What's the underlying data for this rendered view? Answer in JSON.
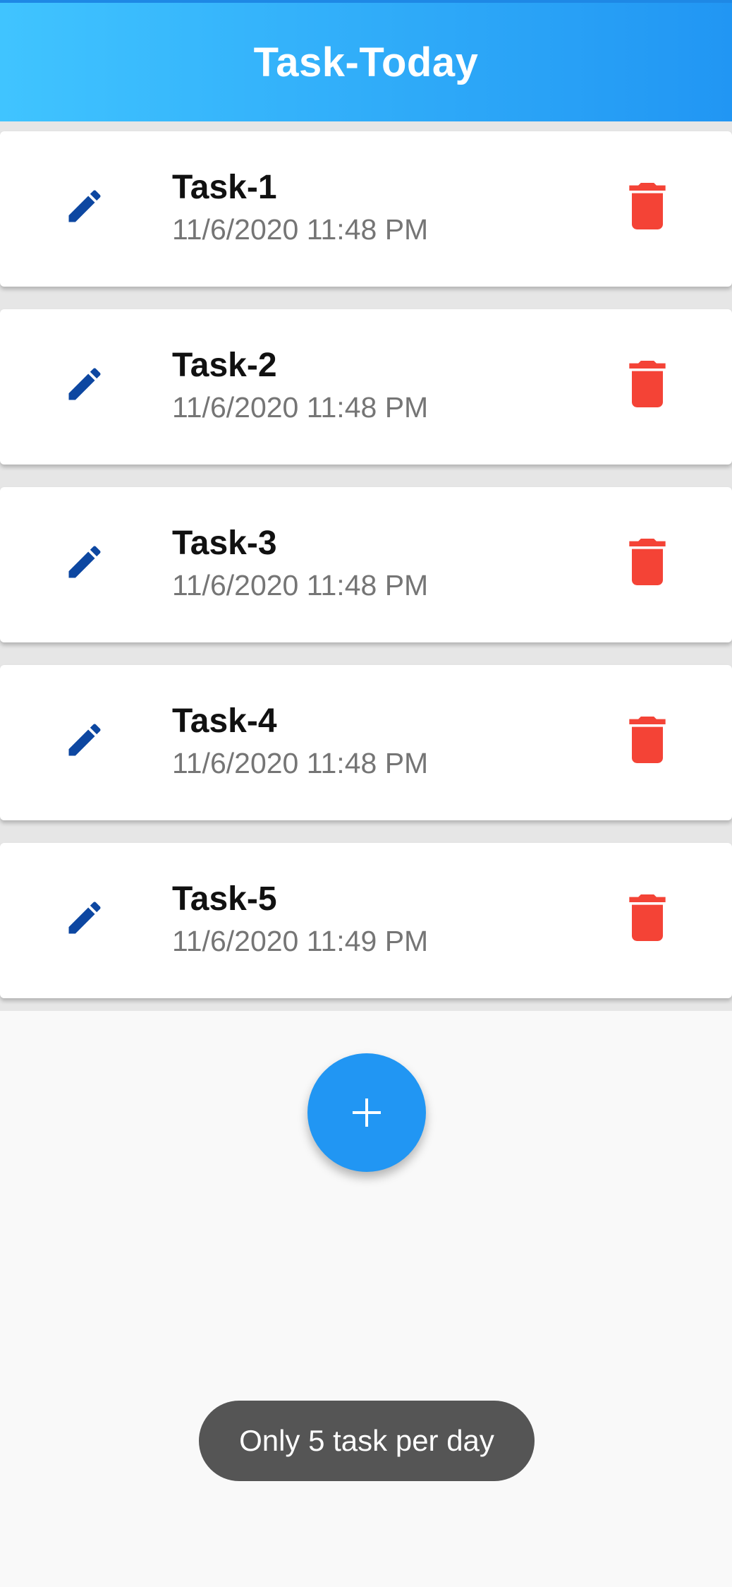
{
  "app_bar": {
    "title": "Task-Today"
  },
  "colors": {
    "app_bar_gradient_start": "#40c4ff",
    "app_bar_gradient_end": "#2196f3",
    "edit_icon": "#0d47a1",
    "delete_icon": "#f44336",
    "fab": "#2196f3",
    "toast_background": "#555555"
  },
  "tasks": [
    {
      "title": "Task-1",
      "time": "11/6/2020 11:48 PM",
      "edit_icon": "pencil-icon",
      "delete_icon": "trash-icon"
    },
    {
      "title": "Task-2",
      "time": "11/6/2020 11:48 PM",
      "edit_icon": "pencil-icon",
      "delete_icon": "trash-icon"
    },
    {
      "title": "Task-3",
      "time": "11/6/2020 11:48 PM",
      "edit_icon": "pencil-icon",
      "delete_icon": "trash-icon"
    },
    {
      "title": "Task-4",
      "time": "11/6/2020 11:48 PM",
      "edit_icon": "pencil-icon",
      "delete_icon": "trash-icon"
    },
    {
      "title": "Task-5",
      "time": "11/6/2020 11:49 PM",
      "edit_icon": "pencil-icon",
      "delete_icon": "trash-icon"
    }
  ],
  "fab": {
    "icon": "plus-icon"
  },
  "toast": {
    "message": "Only 5 task per day"
  }
}
